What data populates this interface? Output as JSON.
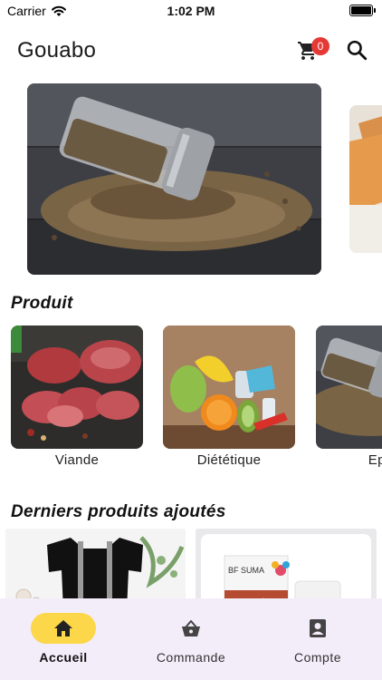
{
  "status_bar": {
    "carrier": "Carrier",
    "time": "1:02 PM"
  },
  "app_bar": {
    "title": "Gouabo",
    "cart_count": "0"
  },
  "banners": [
    {
      "name": "pepper-spice-image"
    },
    {
      "name": "bread-image-partial"
    }
  ],
  "sections": {
    "products_title": "Produit",
    "recent_title": "Derniers produits ajoutés"
  },
  "categories": [
    {
      "label": "Viande"
    },
    {
      "label": "Diététique"
    },
    {
      "label": "Epic"
    }
  ],
  "nav": {
    "items": [
      {
        "label": "Accueil",
        "icon": "home-icon",
        "active": true
      },
      {
        "label": "Commande",
        "icon": "basket-icon",
        "active": false
      },
      {
        "label": "Compte",
        "icon": "account-box-icon",
        "active": false
      }
    ]
  },
  "colors": {
    "accent": "#fbd749",
    "badge": "#e53935",
    "nav_bg": "#f3ecf9"
  }
}
